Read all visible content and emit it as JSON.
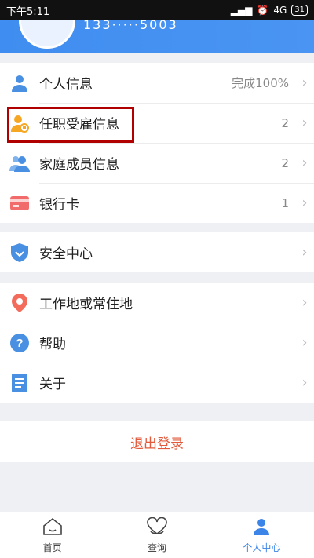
{
  "status_bar": {
    "time": "下午5:11",
    "signal": "4G",
    "battery": "31"
  },
  "header": {
    "phone_masked": "133·····5003"
  },
  "menu_group1": [
    {
      "label": "个人信息",
      "value": "完成100%",
      "icon": "person-icon",
      "color": "#4a90e2"
    },
    {
      "label": "任职受雇信息",
      "value": "2",
      "icon": "employment-icon",
      "color": "#f5a623"
    },
    {
      "label": "家庭成员信息",
      "value": "2",
      "icon": "family-icon",
      "color": "#4a90e2"
    },
    {
      "label": "银行卡",
      "value": "1",
      "icon": "bank-card-icon",
      "color": "#f26b6b"
    }
  ],
  "menu_group2": [
    {
      "label": "安全中心",
      "value": "",
      "icon": "shield-icon",
      "color": "#4a90e2"
    }
  ],
  "menu_group3": [
    {
      "label": "工作地或常住地",
      "value": "",
      "icon": "location-pin-icon",
      "color": "#f26b5b"
    },
    {
      "label": "帮助",
      "value": "",
      "icon": "help-icon",
      "color": "#4a90e2"
    },
    {
      "label": "关于",
      "value": "",
      "icon": "document-icon",
      "color": "#4a90e2"
    }
  ],
  "logout_label": "退出登录",
  "tabs": [
    {
      "label": "首页",
      "icon": "home-icon"
    },
    {
      "label": "查询",
      "icon": "heart-icon"
    },
    {
      "label": "个人中心",
      "icon": "profile-icon",
      "active": true
    }
  ],
  "colors": {
    "accent": "#3b85e8",
    "logout": "#e25a3b",
    "highlight": "#b00000"
  }
}
